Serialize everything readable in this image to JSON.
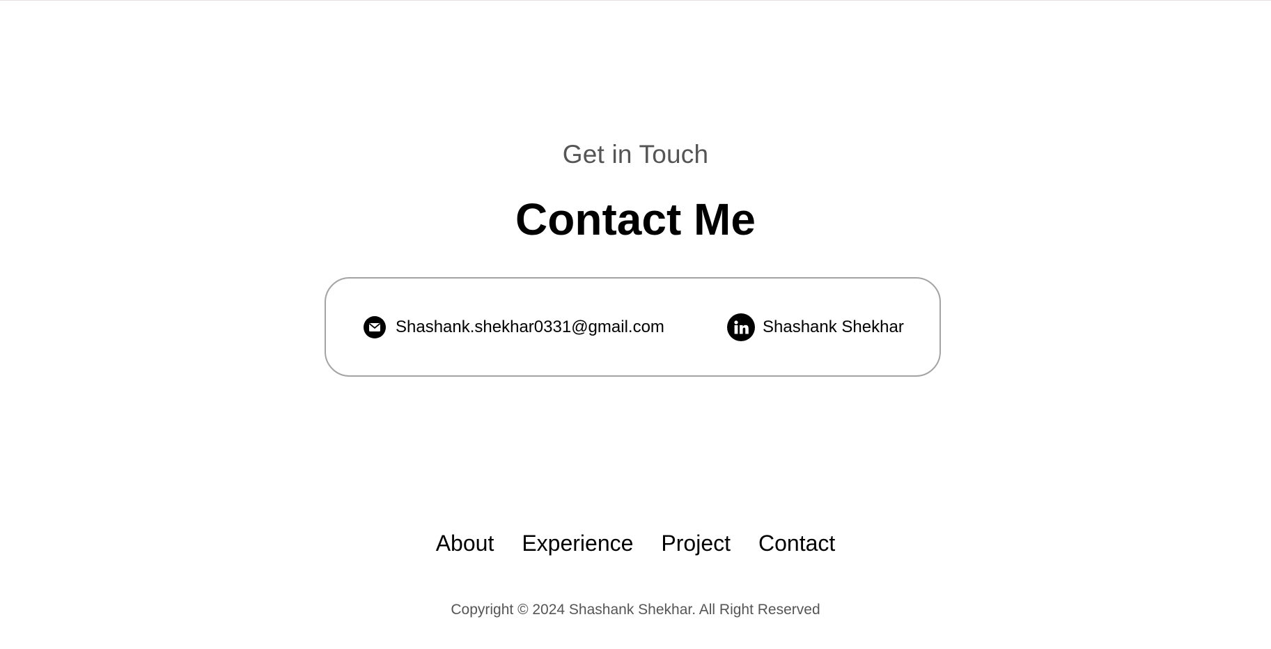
{
  "section": {
    "subtitle": "Get in Touch",
    "title": "Contact Me"
  },
  "contacts": {
    "email": {
      "icon": "mail-icon",
      "label": "Shashank.shekhar0331@gmail.com"
    },
    "linkedin": {
      "icon": "linkedin-icon",
      "label": "Shashank Shekhar"
    }
  },
  "footer": {
    "nav": [
      "About",
      "Experience",
      "Project",
      "Contact"
    ],
    "copyright": "Copyright © 2024 Shashank Shekhar. All Right Reserved"
  },
  "colors": {
    "text": "#000000",
    "muted": "#555555",
    "border": "#a3a3a3",
    "background": "#ffffff"
  }
}
